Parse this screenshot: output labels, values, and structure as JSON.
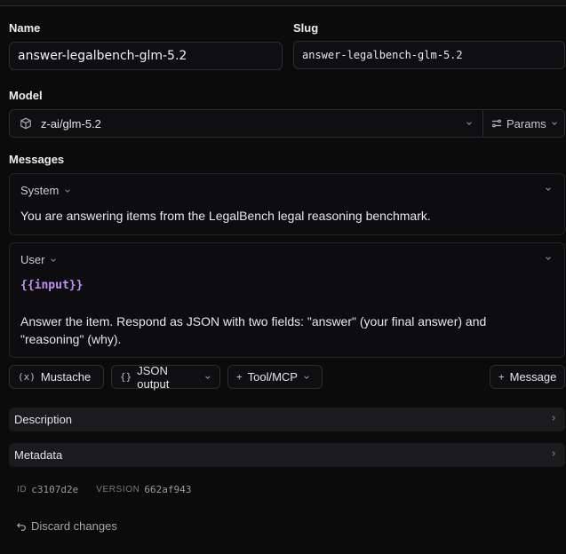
{
  "name": {
    "label": "Name",
    "value": "answer-legalbench-glm-5.2"
  },
  "slug": {
    "label": "Slug",
    "value": "answer-legalbench-glm-5.2"
  },
  "model": {
    "label": "Model",
    "value": "z-ai/glm-5.2",
    "params_label": "Params",
    "icon": "cube-icon"
  },
  "messages": {
    "label": "Messages",
    "items": [
      {
        "role": "System",
        "text": "You are answering items from the LegalBench legal reasoning benchmark."
      },
      {
        "role": "User",
        "variable": "{{input}}",
        "text": "Answer the item. Respond as JSON with two fields: \"answer\" (your final answer) and \"reasoning\" (why)."
      }
    ]
  },
  "toolbar": {
    "mustache": "Mustache",
    "json_output": "JSON output",
    "tool_mcp": "Tool/MCP",
    "add_message": "Message"
  },
  "sections": {
    "description": "Description",
    "metadata": "Metadata"
  },
  "meta": {
    "id_key": "ID",
    "id_value": "c3107d2e",
    "version_key": "VERSION",
    "version_value": "662af943"
  },
  "discard": "Discard changes",
  "colors": {
    "background": "#0b0b0c",
    "variable": "#c48ff7",
    "section_bg": "#1b1b1e"
  }
}
